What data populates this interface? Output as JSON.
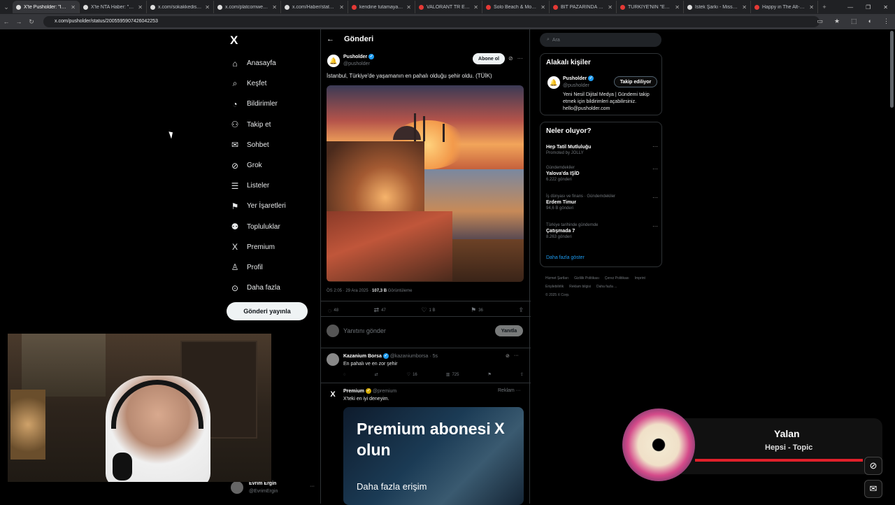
{
  "browser": {
    "tabs": [
      {
        "title": "X'te Pusholder: \"İstanb...",
        "active": true,
        "fav": "x"
      },
      {
        "title": "X'te NTA Haber: \"Maj...",
        "active": false,
        "fav": "x"
      },
      {
        "title": "x.com/sokakkedisitv/st...",
        "active": false,
        "fav": "x"
      },
      {
        "title": "x.com/platcomweb/sta...",
        "active": false,
        "fav": "x"
      },
      {
        "title": "x.com/Haber/status/20...",
        "active": false,
        "fav": "x"
      },
      {
        "title": "kendine tutamayacağı...",
        "active": false,
        "fav": "yt"
      },
      {
        "title": "VALORANT TR ESPOR...",
        "active": false,
        "fav": "yt"
      },
      {
        "title": "Solo Beach & Mounta...",
        "active": false,
        "fav": "yt"
      },
      {
        "title": "BİT PAZARINDA 2 SAA...",
        "active": false,
        "fav": "yt"
      },
      {
        "title": "TÜRKİYE'NİN \"EN KÜÇ...",
        "active": false,
        "fav": "yt"
      },
      {
        "title": "İstek Şarkı - MissXss A...",
        "active": false,
        "fav": "other"
      },
      {
        "title": "Happy in The Alt-Rock...",
        "active": false,
        "fav": "yt"
      }
    ],
    "url": "x.com/pusholder/status/2005595907426042253"
  },
  "nav": {
    "items": [
      {
        "icon": "⌂",
        "label": "Anasayfa",
        "name": "home"
      },
      {
        "icon": "⌕",
        "label": "Keşfet",
        "name": "explore"
      },
      {
        "icon": "◔",
        "label": "Bildirimler",
        "name": "notifications"
      },
      {
        "icon": "⚇",
        "label": "Takip et",
        "name": "follow"
      },
      {
        "icon": "✉",
        "label": "Sohbet",
        "name": "chat"
      },
      {
        "icon": "⊘",
        "label": "Grok",
        "name": "grok"
      },
      {
        "icon": "☰",
        "label": "Listeler",
        "name": "lists"
      },
      {
        "icon": "⚑",
        "label": "Yer İşaretleri",
        "name": "bookmarks"
      },
      {
        "icon": "⚉",
        "label": "Topluluklar",
        "name": "communities"
      },
      {
        "icon": "X",
        "label": "Premium",
        "name": "premium"
      },
      {
        "icon": "♙",
        "label": "Profil",
        "name": "profile"
      },
      {
        "icon": "⊙",
        "label": "Daha fazla",
        "name": "more"
      }
    ],
    "post_button": "Gönderi yayınla",
    "user": {
      "name": "Evrim Ergin",
      "handle": "@EvrimErgin"
    }
  },
  "post": {
    "header": "Gönderi",
    "author": "Pusholder",
    "handle": "@pusholder",
    "subscribe": "Abone ol",
    "text": "İstanbul, Türkiye'de yaşamanın en pahalı olduğu şehir oldu. (TÜİK)",
    "time": "ÖS 2:05 · 29 Ara 2025 · ",
    "views": "107,3 B",
    "views_label": " Görüntüleme",
    "replies": "48",
    "reposts": "47",
    "likes": "1 B",
    "bookmarks": "36",
    "reply_placeholder": "Yanıtını gönder",
    "reply_button": "Yanıtla"
  },
  "comments": [
    {
      "name": "Kazanium Borsa",
      "handle": "@kazaniumborsa · 5s",
      "text": "En pahalı ve en zor şehir",
      "replies": "",
      "reposts": "",
      "likes": "16",
      "views": "725"
    }
  ],
  "ad": {
    "name": "Premium",
    "handle": "@premium",
    "tag": "Reklam",
    "text": "X'teki en iyi deneyim.",
    "headline": "Premium abonesi olun",
    "cta": "Daha fazla erişim"
  },
  "right": {
    "search_placeholder": "Ara",
    "related_title": "Alakalı kişiler",
    "related": {
      "name": "Pusholder",
      "handle": "@pusholder",
      "button": "Takip ediliyor",
      "bio": "Yeni Nesil Dijital Medya | Gündemi takip etmek için bildirimleri açabilirsiniz. hello@pusholder.com"
    },
    "trends_title": "Neler oluyor?",
    "trends": [
      {
        "context": "",
        "name": "Hep Tatil Mutluluğu",
        "meta": "Promoted by JOLLY"
      },
      {
        "context": "Gündemdekiler",
        "name": "Yalova'da IŞİD",
        "meta": "6.222 gönderi"
      },
      {
        "context": "İş dünyası ve finans · Gündemdekiler",
        "name": "Erdem Timur",
        "meta": "94,6 B gönderi"
      },
      {
        "context": "Türkiye tarihinde gündemde",
        "name": "Çatışmada 7",
        "meta": "8.263 gönderi"
      }
    ],
    "show_more": "Daha fazla göster",
    "footer": [
      "Hizmet Şartları",
      "Gizlilik Politikası",
      "Çerez Politikası",
      "Imprint",
      "Erişilebilirlik",
      "Reklam bilgisi",
      "Daha fazla ...",
      "© 2025 X Corp."
    ]
  },
  "music": {
    "title": "Yalan",
    "artist": "Hepsi - Topic"
  }
}
